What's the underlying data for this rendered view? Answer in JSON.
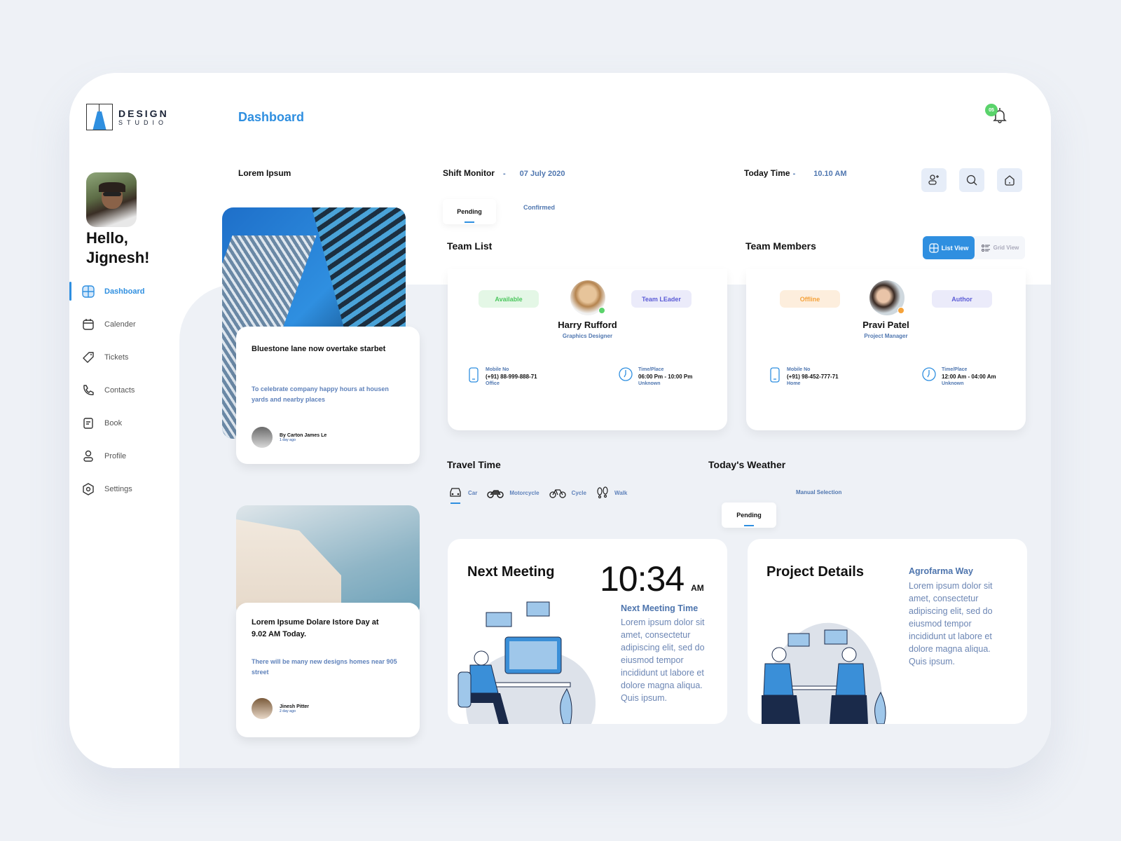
{
  "app": {
    "logo_line1": "DESIGN",
    "logo_line2": "STUDIO",
    "page_title": "Dashboard",
    "notification_count": "05"
  },
  "user": {
    "greeting_line1": "Hello,",
    "greeting_line2": "Jignesh!"
  },
  "sidebar": {
    "items": [
      {
        "label": "Dashboard",
        "icon": "dashboard-icon",
        "active": true
      },
      {
        "label": "Calender",
        "icon": "calendar-icon"
      },
      {
        "label": "Tickets",
        "icon": "tag-icon"
      },
      {
        "label": "Contacts",
        "icon": "phone-icon"
      },
      {
        "label": "Book",
        "icon": "book-icon"
      },
      {
        "label": "Profile",
        "icon": "user-icon"
      },
      {
        "label": "Settings",
        "icon": "settings-icon"
      }
    ]
  },
  "header": {
    "lorem_label": "Lorem Ipsum",
    "shift_label": "Shift Monitor",
    "shift_sep": "-",
    "shift_date": "07 July 2020",
    "today_label": "Today Time",
    "today_sep": "-",
    "today_time": "10.10 AM",
    "actions": [
      "add-user-icon",
      "search-icon",
      "home-icon"
    ]
  },
  "shift_tabs": [
    {
      "label": "Pending",
      "active": true
    },
    {
      "label": "Confirmed"
    }
  ],
  "team_list": {
    "title": "Team List"
  },
  "team_members": {
    "title": "Team Members",
    "view_list": "List View",
    "view_grid": "Grid View"
  },
  "members": [
    {
      "status": "Available",
      "role_badge": "Team LEader",
      "name": "Harry Rufford",
      "title": "Graphics Designer",
      "mobile_label": "Mobile No",
      "mobile": "(+91) 88-999-888-71",
      "mobile_type": "Office",
      "time_label": "Time/Place",
      "time": "06:00 Pm - 10:00 Pm",
      "place": "Unknown",
      "status_color": "#5ad36b"
    },
    {
      "status": "Offline",
      "role_badge": "Author",
      "name": "Pravi Patel",
      "title": "Project Manager",
      "mobile_label": "Mobile No",
      "mobile": "(+91) 98-452-777-71",
      "mobile_type": "Home",
      "time_label": "Time/Place",
      "time": "12:00 Am - 04:00 Am",
      "place": "Unknown",
      "status_color": "#f5a23a"
    }
  ],
  "news": [
    {
      "title": "Bluestone lane now overtake starbet",
      "subtitle": "To celebrate company happy hours at housen yards and nearby places",
      "author": "By Carton James Le",
      "time": "1 day ago"
    },
    {
      "title": "Lorem Ipsume Dolare Istore Day at 9.02 AM Today.",
      "subtitle": "There will be many new designs homes near 905 street",
      "author": "Jinesh Pitter",
      "time": "2 day ago"
    }
  ],
  "travel": {
    "title": "Travel Time",
    "modes": [
      {
        "label": "Car",
        "icon": "car-icon",
        "active": true
      },
      {
        "label": "Motorcycle",
        "icon": "motorcycle-icon"
      },
      {
        "label": "Cycle",
        "icon": "bicycle-icon"
      },
      {
        "label": "Walk",
        "icon": "footprints-icon"
      }
    ]
  },
  "weather": {
    "title": "Today's Weather",
    "tabs": [
      {
        "label": "Pending",
        "active": true
      },
      {
        "label": "Manual Selection"
      }
    ]
  },
  "meeting": {
    "title": "Next Meeting",
    "time": "10:34",
    "ampm": "AM",
    "subtitle": "Next Meeting Time",
    "body": "Lorem ipsum dolor sit amet, consectetur adipiscing elit, sed do eiusmod tempor incididunt ut labore et dolore magna aliqua. Quis ipsum."
  },
  "project": {
    "title": "Project Details",
    "subtitle": "Agrofarma Way",
    "body": "Lorem ipsum dolor sit amet, consectetur adipiscing elit, sed do eiusmod tempor incididunt ut labore et dolore magna aliqua. Quis ipsum."
  },
  "colors": {
    "accent": "#2f8fe0",
    "available_bg": "#e4f7e6",
    "available_fg": "#4cc75e",
    "offline_bg": "#fdeedd",
    "offline_fg": "#f5a23a",
    "role_bg": "#ebebfa",
    "role_fg": "#5b5bd6"
  }
}
